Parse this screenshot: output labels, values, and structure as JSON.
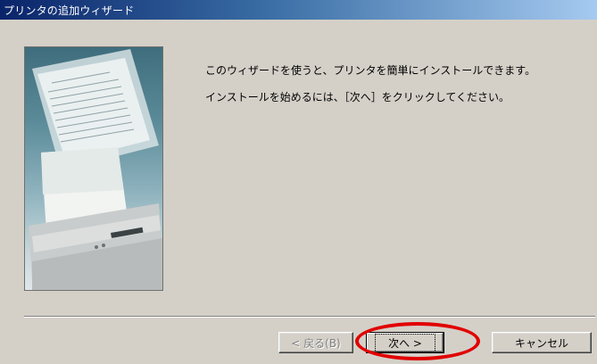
{
  "window": {
    "title": "プリンタの追加ウィザード"
  },
  "intro": {
    "line1": "このウィザードを使うと、プリンタを簡単にインストールできます。",
    "line2": "インストールを始めるには、［次へ］をクリックしてください。"
  },
  "buttons": {
    "back_label": "< 戻る(B)",
    "next_label": "次へ >",
    "cancel_label": "キャンセル",
    "back_enabled": false
  },
  "annotation": {
    "highlight_color": "#e10000",
    "highlighted": "next-button"
  },
  "colors": {
    "titlebar_start": "#0a246a",
    "titlebar_end": "#a6caf0",
    "dialog_face": "#d4d0c8"
  }
}
